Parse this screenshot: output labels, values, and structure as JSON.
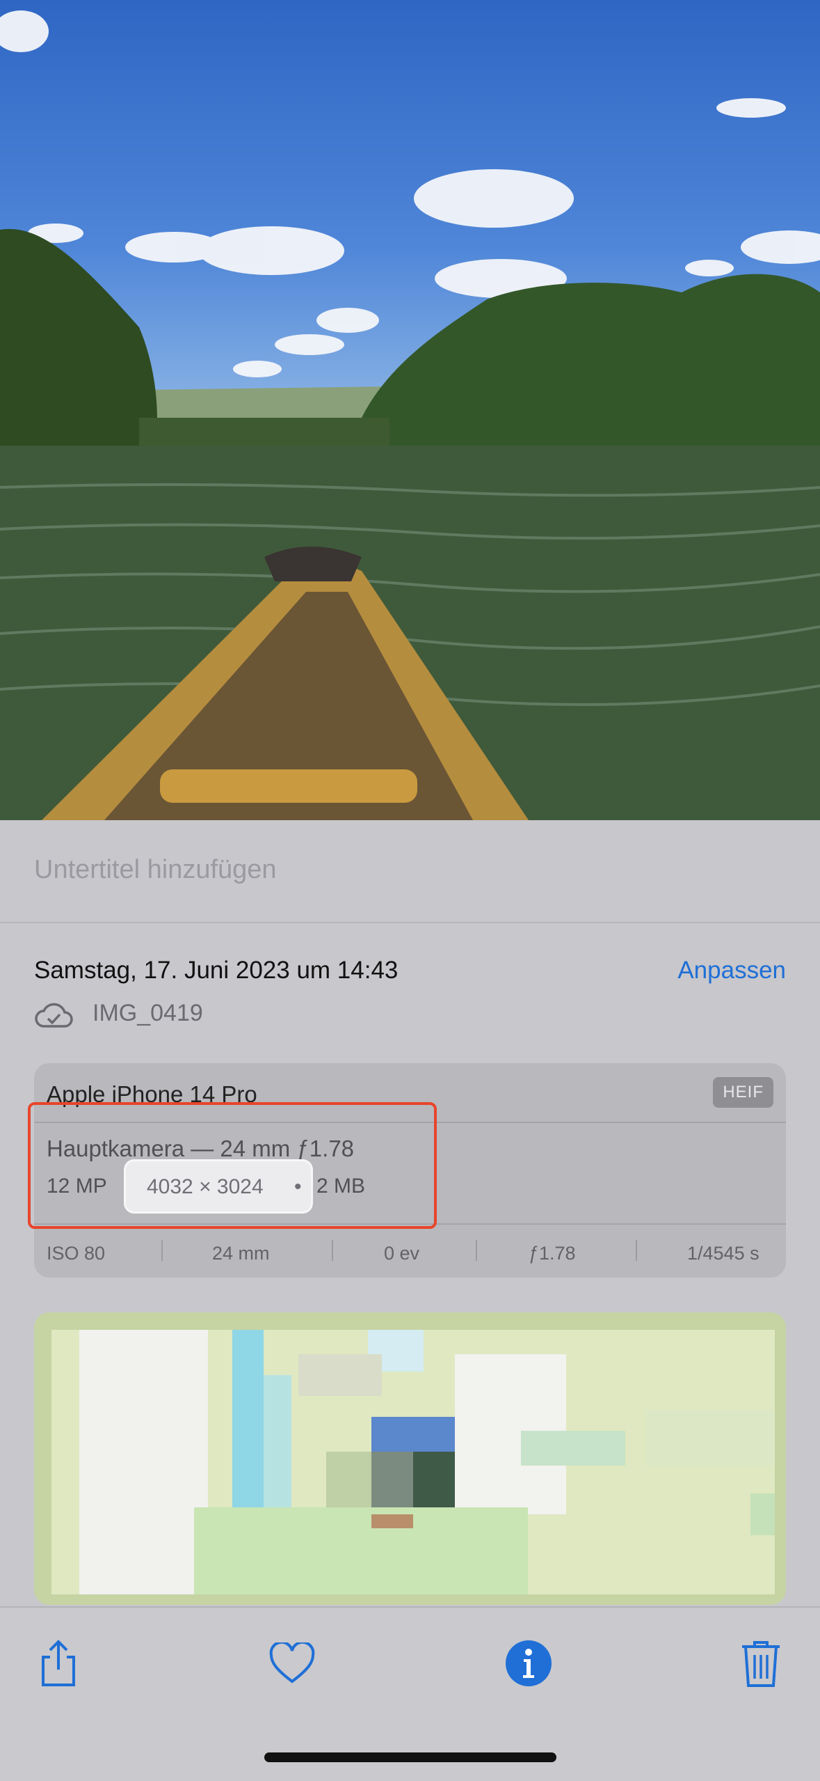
{
  "caption": {
    "placeholder": "Untertitel hinzufügen"
  },
  "info": {
    "date": "Samstag, 17. Juni 2023 um 14:43",
    "adjust_label": "Anpassen",
    "cloud_icon": "icloud-check-icon",
    "filename": "IMG_0419"
  },
  "exif": {
    "device": "Apple iPhone 14 Pro",
    "format": "HEIF",
    "lens": "Hauptkamera — 24 mm ƒ1.78",
    "megapixels": "12 MP",
    "dot": "•",
    "resolution": "4032 × 3024",
    "filesize": "2 MB",
    "iso": "ISO 80",
    "focal": "24 mm",
    "ev": "0 ev",
    "aperture": "ƒ1.78",
    "shutter": "1/4545 s"
  },
  "toolbar": {
    "share_icon": "share-icon",
    "favorite_icon": "heart-icon",
    "info_icon": "info-icon",
    "delete_icon": "trash-icon"
  },
  "colors": {
    "accent": "#1f6fd6",
    "highlight": "#e8452b"
  }
}
